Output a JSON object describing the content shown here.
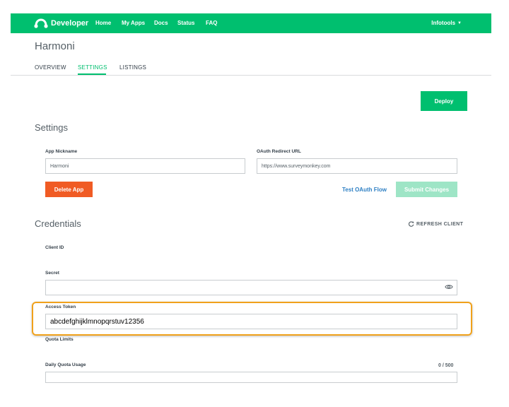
{
  "header": {
    "brand": "Developer",
    "nav": [
      "Home",
      "My Apps",
      "Docs",
      "Status",
      "FAQ"
    ],
    "user_menu": "Infotools",
    "bg_color": "#00bf6f"
  },
  "app": {
    "title": "Harmoni",
    "tabs": [
      "OVERVIEW",
      "SETTINGS",
      "LISTINGS"
    ],
    "active_tab": "SETTINGS"
  },
  "actions": {
    "deploy_label": "Deploy"
  },
  "settings": {
    "title": "Settings",
    "nickname_label": "App Nickname",
    "nickname_value": "Harmoni",
    "redirect_label": "OAuth Redirect URL",
    "redirect_value": "https://www.surveymonkey.com",
    "delete_label": "Delete App",
    "test_oauth_label": "Test OAuth Flow",
    "submit_label": "Submit Changes"
  },
  "credentials": {
    "title": "Credentials",
    "refresh_label": "REFRESH CLIENT",
    "client_id_label": "Client ID",
    "secret_label": "Secret",
    "secret_value": "",
    "access_token_label": "Access Token",
    "access_token_value": "abcdefghijklmnopqrstuv12356",
    "quota_limits_label": "Quota Limits",
    "daily_quota_label": "Daily Quota Usage",
    "daily_quota_count": "0 / 500",
    "daily_quota_value": ""
  },
  "colors": {
    "accent": "#00bf6f",
    "danger": "#f05b24",
    "link": "#2f80c4",
    "highlight": "#f0a11b"
  }
}
